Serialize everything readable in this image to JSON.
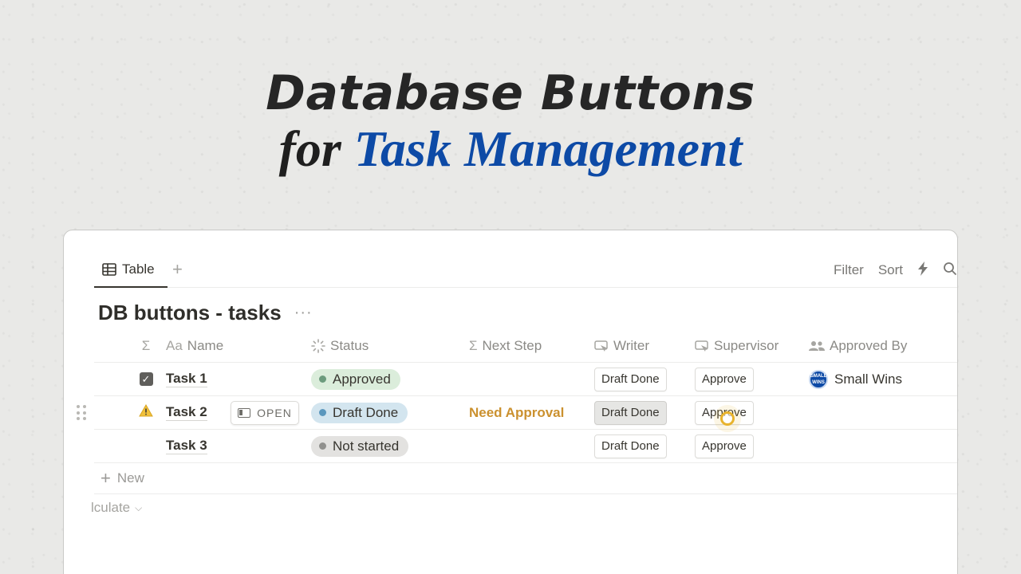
{
  "headline": {
    "line1": "Database Buttons",
    "line2_lead": "for ",
    "line2_accent": "Task Management"
  },
  "colors": {
    "accent": "#0d4aa6",
    "next_step": "#cb912f",
    "status_green": "#dbeddb",
    "status_blue": "#d3e5ef",
    "status_gray": "#e3e2e0"
  },
  "tabbar": {
    "tab_label": "Table",
    "add_view": "+",
    "filter": "Filter",
    "sort": "Sort",
    "automation_icon": "⚡",
    "search_icon": "⌕"
  },
  "database": {
    "title": "DB buttons - tasks",
    "more": "···"
  },
  "columns": {
    "sigma": "Σ",
    "name_prefix": "Aa",
    "name": "Name",
    "status": "Status",
    "next_step": "Next Step",
    "writer": "Writer",
    "supervisor": "Supervisor",
    "approved_by": "Approved By"
  },
  "rows": [
    {
      "name": "Task 1",
      "status": "Approved",
      "next_step": "",
      "writer": "Draft Done",
      "supervisor": "Approve",
      "approved_by": "Small Wins"
    },
    {
      "name": "Task 2",
      "open": "OPEN",
      "status": "Draft Done",
      "next_step": "Need Approval",
      "writer": "Draft Done",
      "supervisor": "Approve",
      "approved_by": ""
    },
    {
      "name": "Task 3",
      "status": "Not started",
      "next_step": "",
      "writer": "Draft Done",
      "supervisor": "Approve",
      "approved_by": ""
    }
  ],
  "avatar_text": "SMALL WINS",
  "footer": {
    "new": "New",
    "calculate": "lculate"
  }
}
